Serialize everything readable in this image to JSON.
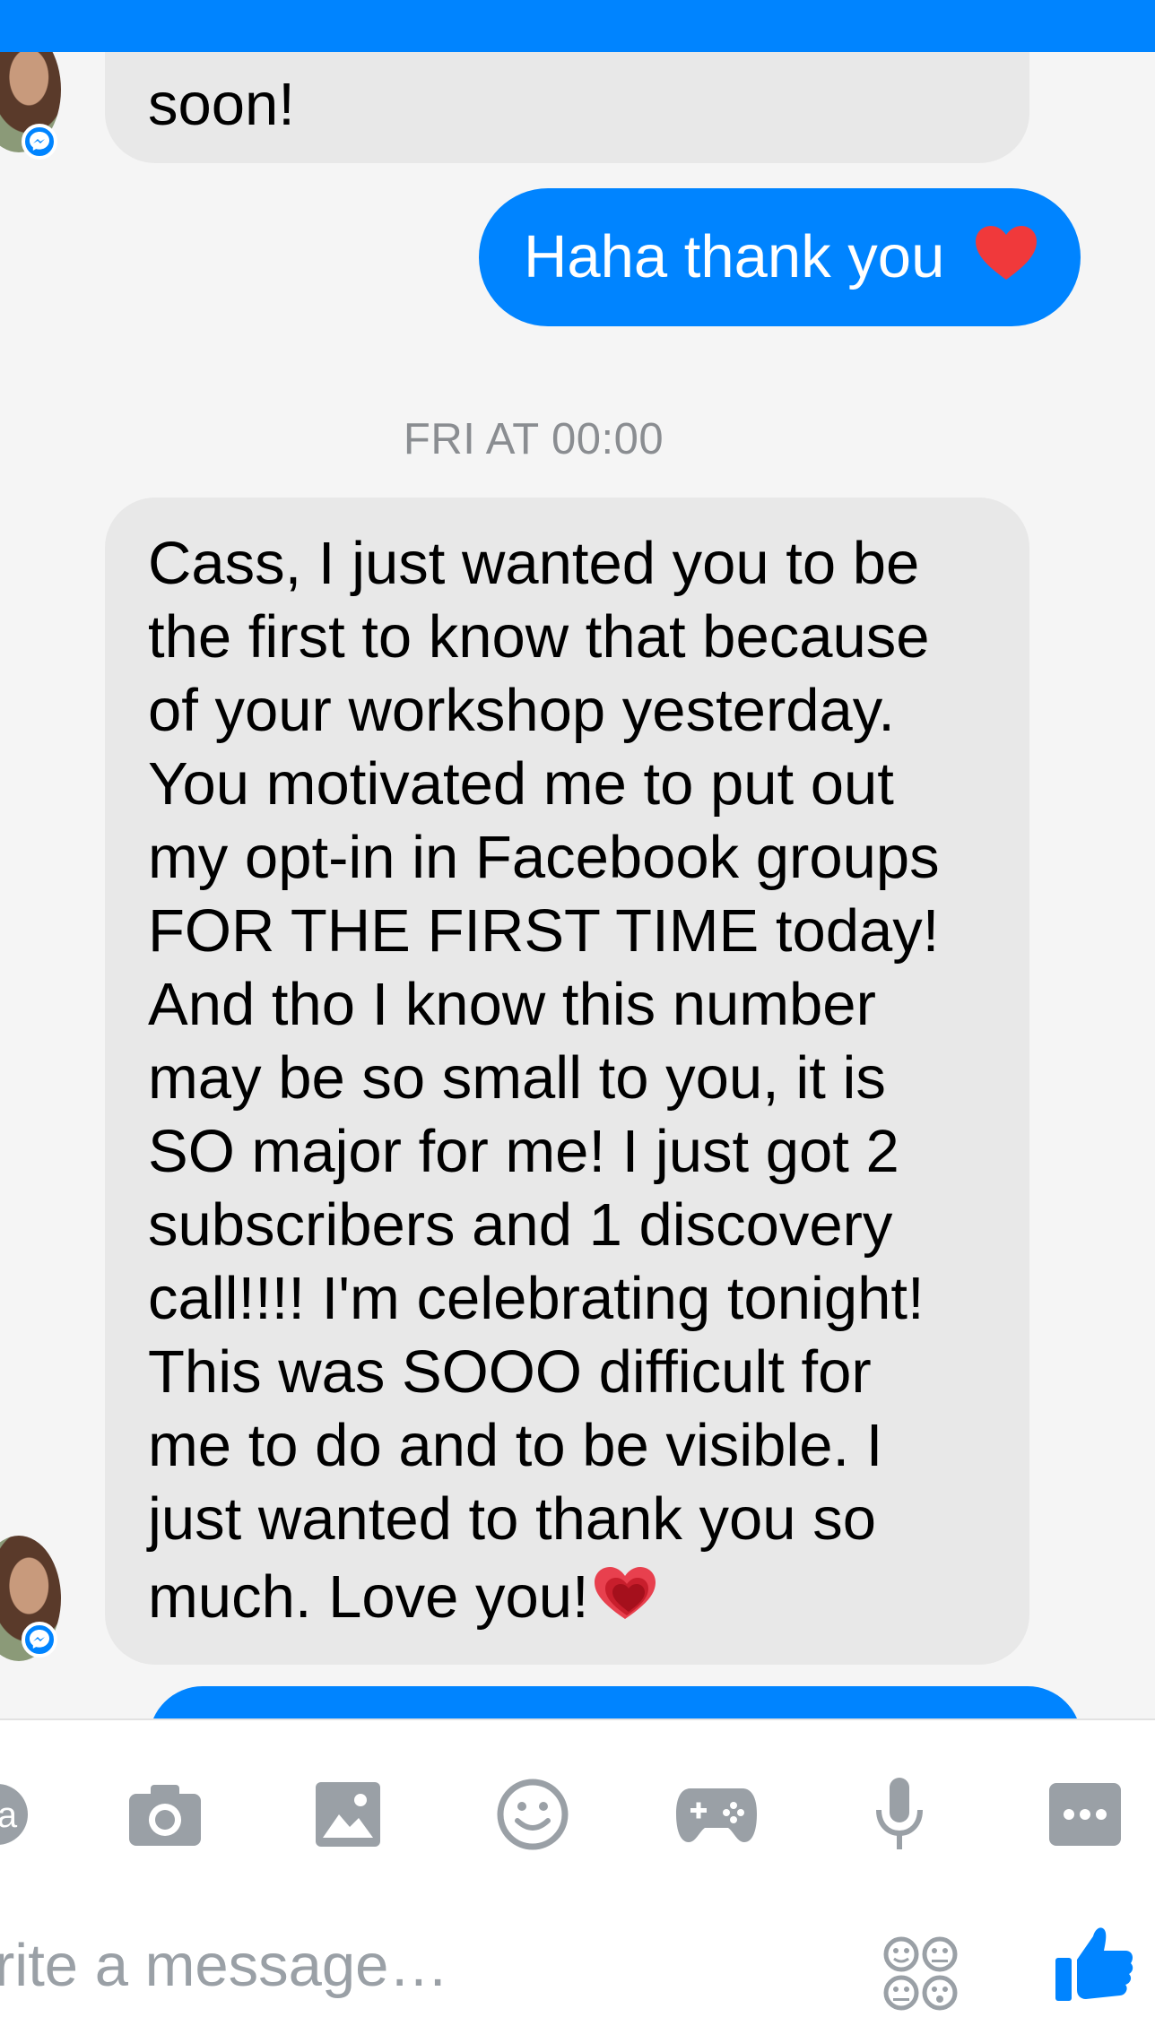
{
  "thread": {
    "prev_incoming_tail": "soon!",
    "outgoing_reply": "Haha thank you",
    "timestamp": "FRI AT 00:00",
    "incoming_lines": [
      "Cass, I just wanted you to be",
      "the first to know that because",
      "of your workshop yesterday.",
      "You motivated me to put out",
      "my opt-in in Facebook groups",
      "FOR THE FIRST TIME today!",
      "And tho I know this number",
      "may be so small to you, it is",
      "SO major for me! I just got 2",
      "subscribers and 1 discovery",
      "call!!!! I'm celebrating tonight!",
      "This was SOOO difficult for",
      "me to do and to be visible. I",
      "just wanted to thank you so",
      "much. Love you!"
    ]
  },
  "toolbar": {
    "icons": [
      "partial-icon",
      "camera-icon",
      "gallery-icon",
      "emoji-icon",
      "game-controller-icon",
      "microphone-icon",
      "more-icon"
    ]
  },
  "composer": {
    "placeholder": "rite a message…",
    "stickers_icon": "stickers-icon",
    "like_icon": "thumbs-up-icon"
  },
  "colors": {
    "brand": "#0084ff",
    "incoming_bubble": "#e8e8e8",
    "background": "#f5f5f5"
  }
}
